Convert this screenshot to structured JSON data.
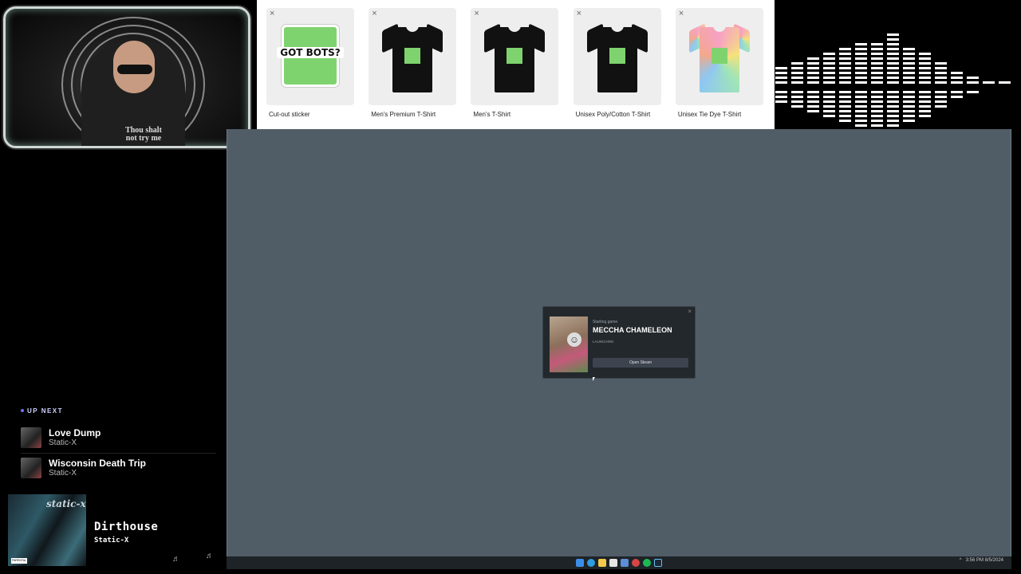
{
  "webcam": {
    "shirt_text": "Thou shalt not try me"
  },
  "merch": {
    "close_glyph": "×",
    "items": [
      {
        "label": "Cut-out sticker",
        "type": "sticker",
        "print": "GOT BOTS?"
      },
      {
        "label": "Men's Premium T-Shirt",
        "type": "tee"
      },
      {
        "label": "Men's T-Shirt",
        "type": "tee"
      },
      {
        "label": "Unisex Poly/Cotton T-Shirt",
        "type": "tee"
      },
      {
        "label": "Unisex Tie Dye T-Shirt",
        "type": "tee-dye"
      }
    ]
  },
  "dialog": {
    "close_glyph": "×",
    "subtitle": "Starting game",
    "title": "MECCHA CHAMELEON",
    "status": "LAUNCHING",
    "button": "Open Steam"
  },
  "taskbar": {
    "tray_time": "3:56 PM",
    "tray_date": "8/5/2024"
  },
  "upnext": {
    "heading": "UP NEXT",
    "songs": [
      {
        "name": "Love Dump",
        "artist": "Static-X"
      },
      {
        "name": "Wisconsin Death Trip",
        "artist": "Static-X"
      }
    ]
  },
  "now_playing": {
    "title": "Dirthouse",
    "artist": "Static-X",
    "album_logo": "static-x",
    "advisory": "PARENTAL ADVISORY",
    "note_glyph": "♬"
  },
  "colors": {
    "desktop_bg": "#505d67",
    "dialog_bg": "#23282d",
    "merch_green": "#7fd36e",
    "upnext_accent": "#6e74ff"
  }
}
